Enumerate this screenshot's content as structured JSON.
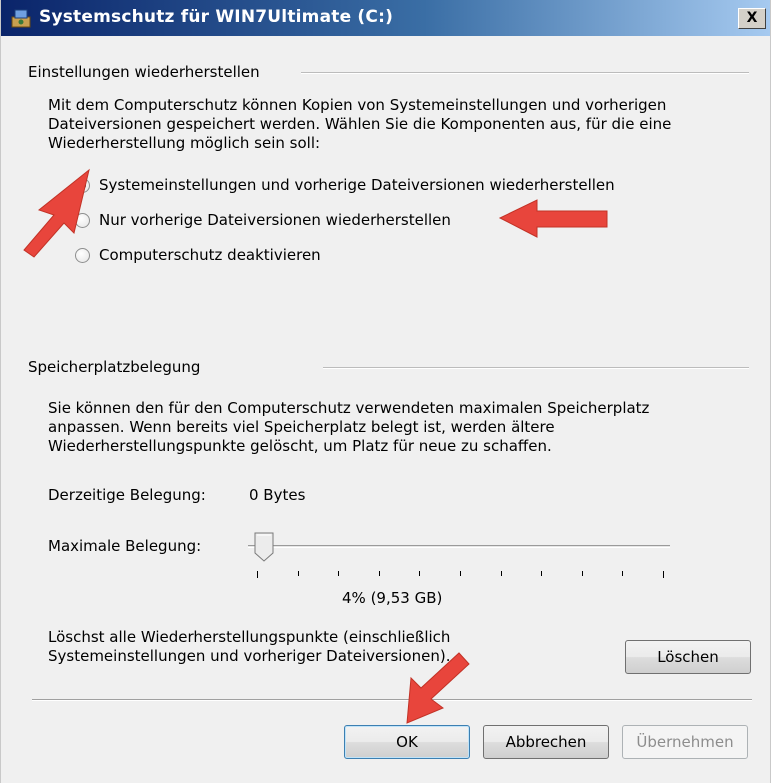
{
  "window": {
    "title": "Systemschutz für WIN7Ultimate (C:)",
    "close_glyph": "X",
    "icon": "system-protection-icon"
  },
  "restore_settings": {
    "group_title": "Einstellungen wiederherstellen",
    "description_lines": [
      "Mit dem Computerschutz können Kopien von Systemeinstellungen und vorherigen",
      "Dateiversionen gespeichert werden. Wählen Sie die Komponenten aus, für die eine",
      "Wiederherstellung möglich sein soll:"
    ],
    "options": [
      {
        "label": "Systemeinstellungen und vorherige Dateiversionen wiederherstellen",
        "selected": true
      },
      {
        "label": "Nur vorherige Dateiversionen wiederherstellen",
        "selected": false
      },
      {
        "label": "Computerschutz deaktivieren",
        "selected": false
      }
    ]
  },
  "disk_usage": {
    "group_title": "Speicherplatzbelegung",
    "description_lines": [
      "Sie können den für den Computerschutz verwendeten maximalen Speicherplatz",
      "anpassen. Wenn bereits viel Speicherplatz belegt ist, werden ältere",
      "Wiederherstellungspunkte gelöscht, um Platz für neue zu schaffen."
    ],
    "current_usage_label": "Derzeitige Belegung:",
    "current_usage_value": "0 Bytes",
    "max_usage_label": "Maximale Belegung:",
    "max_usage_percent": 4,
    "max_usage_display": "4% (9,53 GB)",
    "delete_text_lines": [
      "Löschst alle Wiederherstellungspunkte (einschließlich",
      "Systemeinstellungen und vorheriger Dateiversionen)."
    ],
    "delete_button": "Löschen"
  },
  "buttons": {
    "ok": "OK",
    "cancel": "Abbrechen",
    "apply": "Übernehmen"
  },
  "colors": {
    "annotation_arrow": "#e8453c",
    "title_bar": "#0a246a"
  }
}
